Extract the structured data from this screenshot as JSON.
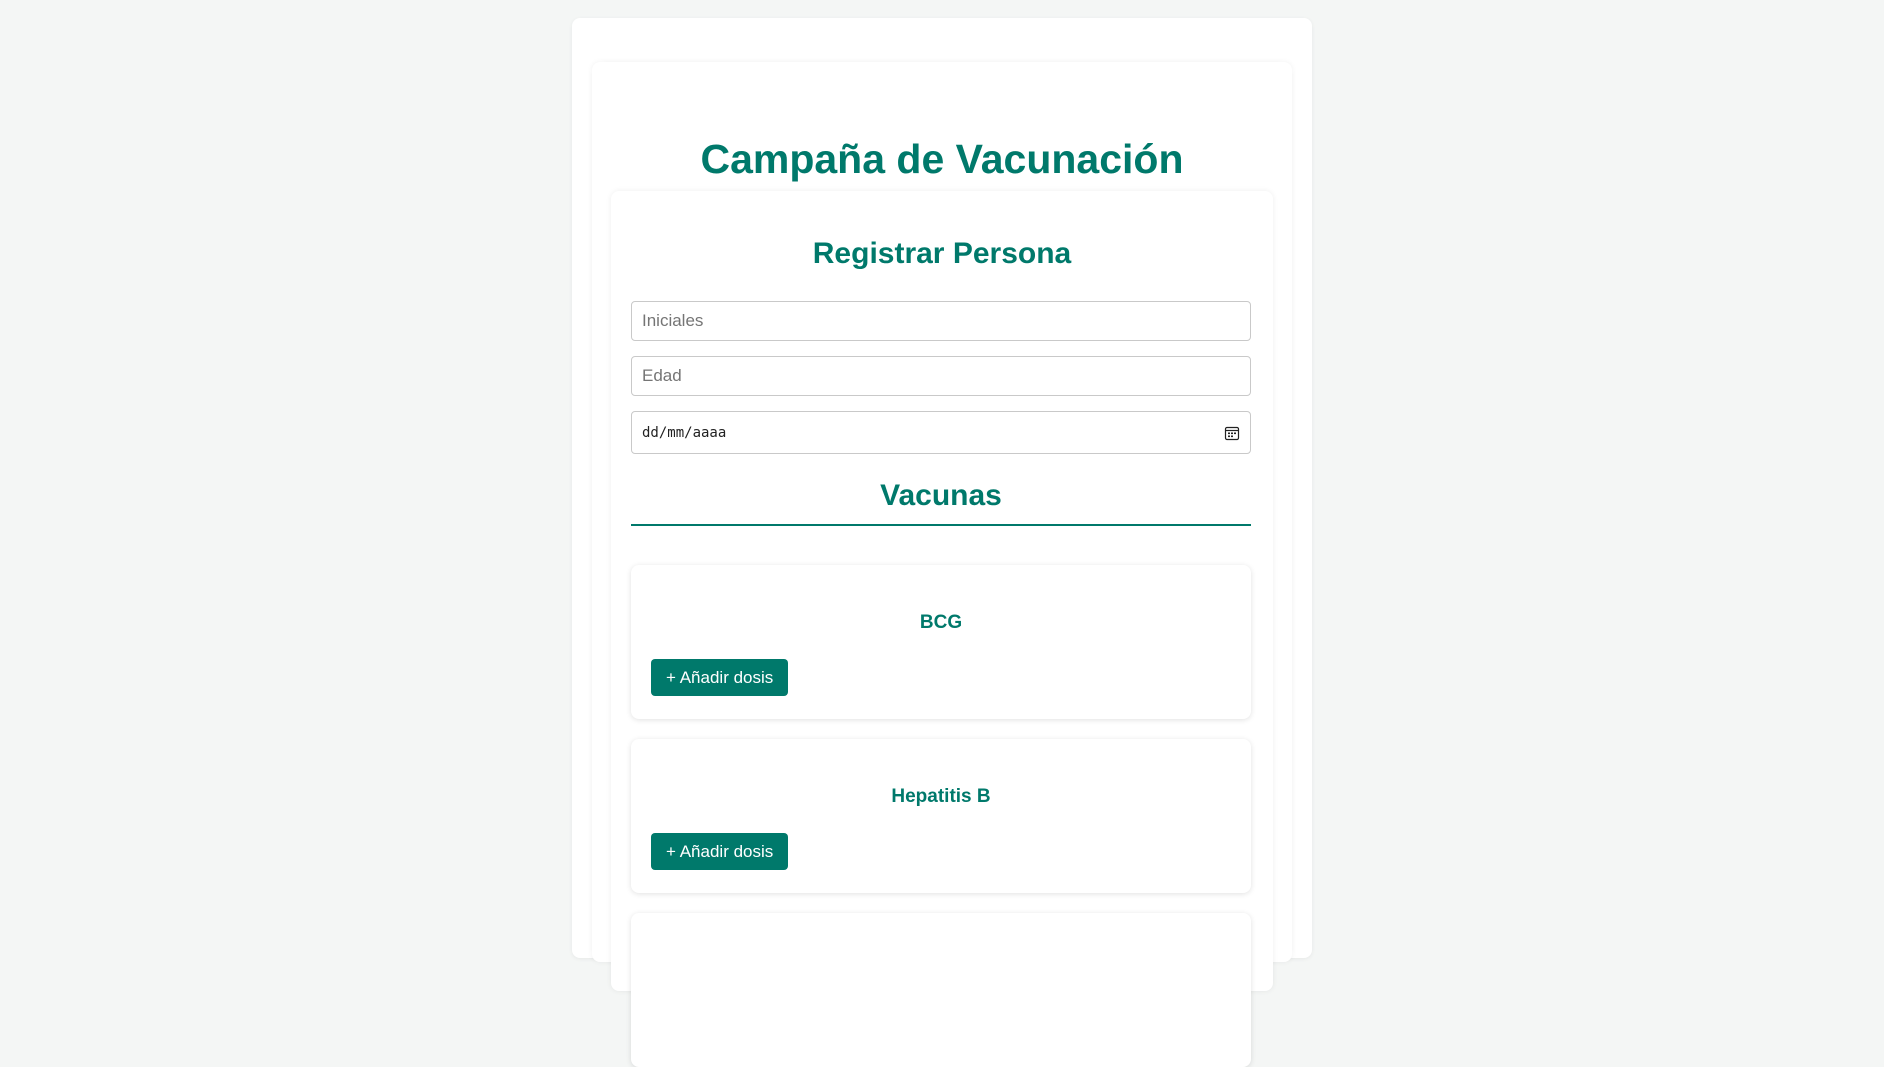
{
  "app": {
    "title": "Campaña de Vacunación"
  },
  "registration": {
    "title": "Registrar Persona",
    "initials_placeholder": "Iniciales",
    "initials_value": "",
    "age_placeholder": "Edad",
    "age_value": "",
    "date_placeholder": "dd/mm/aaaa",
    "date_icon": "calendar-icon"
  },
  "vaccines": {
    "title": "Vacunas",
    "items": [
      {
        "name": "BCG",
        "add_dose_label": "+ Añadir dosis"
      },
      {
        "name": "Hepatitis B",
        "add_dose_label": "+ Añadir dosis"
      }
    ]
  },
  "colors": {
    "accent": "#00796b",
    "background": "#f4f6f5",
    "card": "#ffffff"
  }
}
